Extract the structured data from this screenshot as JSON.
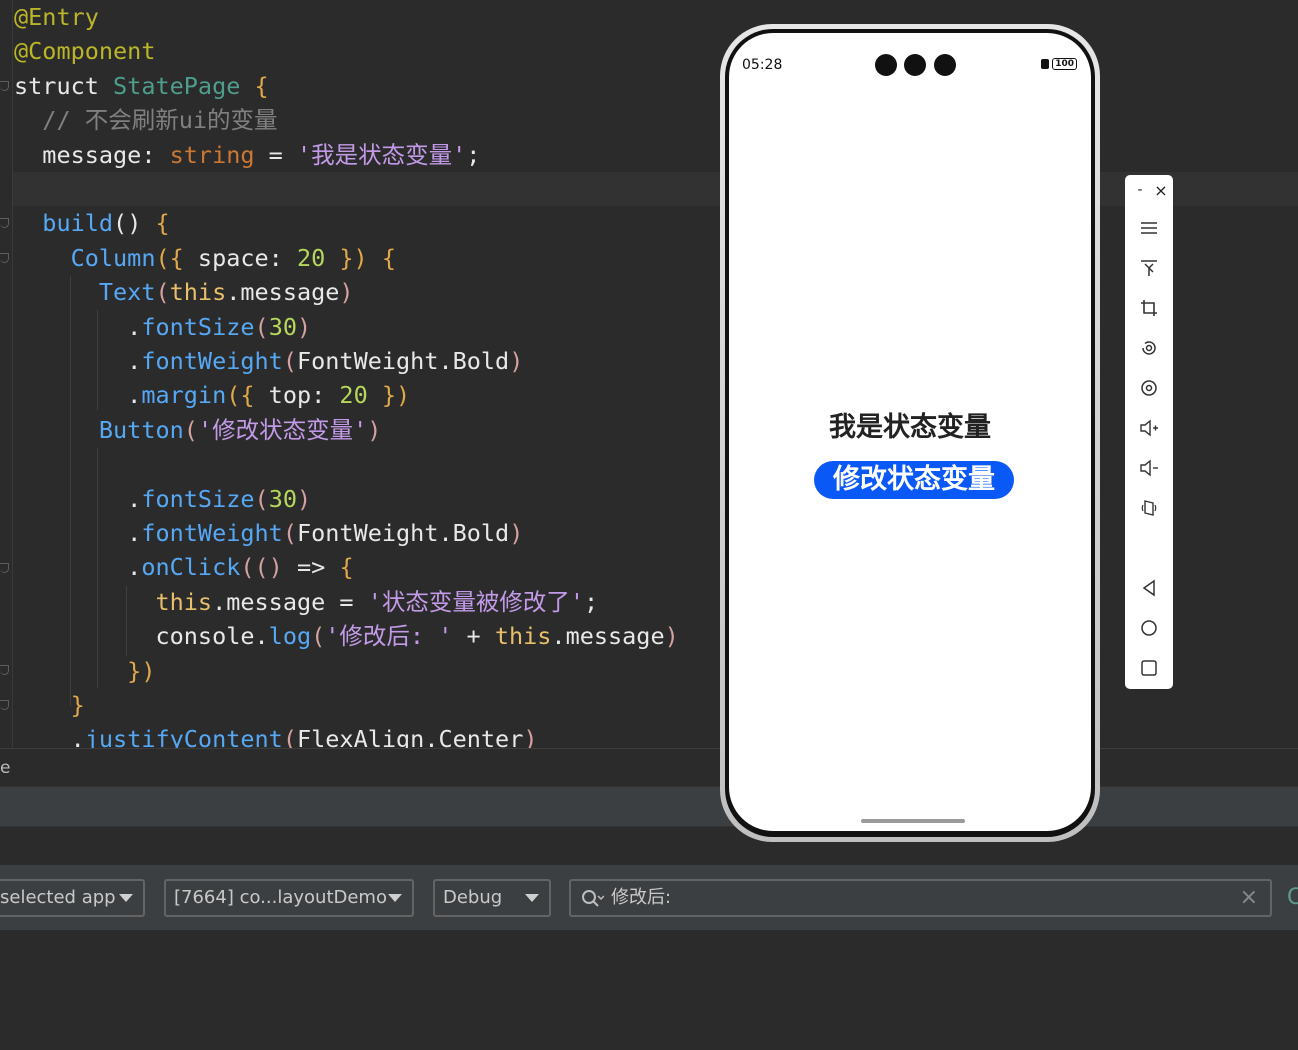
{
  "editor": {
    "lines": [
      {
        "parts": [
          [
            "ann",
            "@Entry"
          ]
        ]
      },
      {
        "parts": [
          [
            "ann",
            "@Component"
          ]
        ]
      },
      {
        "parts": [
          [
            "plain",
            "struct "
          ],
          [
            "cls",
            "StatePage"
          ],
          [
            "plain",
            " "
          ],
          [
            "punc",
            "{"
          ]
        ]
      },
      {
        "parts": [
          [
            "cmt",
            "  // 不会刷新ui的变量"
          ]
        ]
      },
      {
        "parts": [
          [
            "plain",
            "  message"
          ],
          [
            "plain",
            ": "
          ],
          [
            "kw",
            "string"
          ],
          [
            "plain",
            " = "
          ],
          [
            "str",
            "'我是状态变量'"
          ],
          [
            "plain",
            ";"
          ]
        ]
      },
      {
        "parts": [
          [
            "plain",
            ""
          ]
        ]
      },
      {
        "parts": [
          [
            "fn",
            "  build"
          ],
          [
            "plain",
            "() "
          ],
          [
            "punc",
            "{"
          ]
        ]
      },
      {
        "parts": [
          [
            "fn",
            "    Column"
          ],
          [
            "punc",
            "({"
          ],
          [
            "plain",
            " space: "
          ],
          [
            "num",
            "20"
          ],
          [
            "punc",
            " })"
          ],
          [
            "plain",
            " "
          ],
          [
            "punc",
            "{"
          ]
        ]
      },
      {
        "parts": [
          [
            "fn",
            "      Text"
          ],
          [
            "par",
            "("
          ],
          [
            "this",
            "this"
          ],
          [
            "plain",
            ".message"
          ],
          [
            "par",
            ")"
          ]
        ]
      },
      {
        "parts": [
          [
            "plain",
            "        ."
          ],
          [
            "fn",
            "fontSize"
          ],
          [
            "par",
            "("
          ],
          [
            "num",
            "30"
          ],
          [
            "par",
            ")"
          ]
        ]
      },
      {
        "parts": [
          [
            "plain",
            "        ."
          ],
          [
            "fn",
            "fontWeight"
          ],
          [
            "par",
            "("
          ],
          [
            "plain",
            "FontWeight.Bold"
          ],
          [
            "par",
            ")"
          ]
        ]
      },
      {
        "parts": [
          [
            "plain",
            "        ."
          ],
          [
            "fn",
            "margin"
          ],
          [
            "punc",
            "({"
          ],
          [
            "plain",
            " top: "
          ],
          [
            "num",
            "20"
          ],
          [
            "punc",
            " })"
          ]
        ]
      },
      {
        "parts": [
          [
            "fn",
            "      Button"
          ],
          [
            "par",
            "("
          ],
          [
            "str",
            "'修改状态变量'"
          ],
          [
            "par",
            ")"
          ]
        ]
      },
      {
        "parts": [
          [
            "plain",
            ""
          ]
        ]
      },
      {
        "parts": [
          [
            "plain",
            "        ."
          ],
          [
            "fn",
            "fontSize"
          ],
          [
            "par",
            "("
          ],
          [
            "num",
            "30"
          ],
          [
            "par",
            ")"
          ]
        ]
      },
      {
        "parts": [
          [
            "plain",
            "        ."
          ],
          [
            "fn",
            "fontWeight"
          ],
          [
            "par",
            "("
          ],
          [
            "plain",
            "FontWeight.Bold"
          ],
          [
            "par",
            ")"
          ]
        ]
      },
      {
        "parts": [
          [
            "plain",
            "        ."
          ],
          [
            "fn",
            "onClick"
          ],
          [
            "par",
            "(()"
          ],
          [
            "plain",
            " => "
          ],
          [
            "punc",
            "{"
          ]
        ]
      },
      {
        "parts": [
          [
            "this",
            "          this"
          ],
          [
            "plain",
            ".message = "
          ],
          [
            "str",
            "'状态变量被修改了'"
          ],
          [
            "plain",
            ";"
          ]
        ]
      },
      {
        "parts": [
          [
            "plain",
            "          console."
          ],
          [
            "fn",
            "log"
          ],
          [
            "par",
            "("
          ],
          [
            "str",
            "'修改后: '"
          ],
          [
            "plain",
            " + "
          ],
          [
            "this",
            "this"
          ],
          [
            "plain",
            ".message"
          ],
          [
            "par",
            ")"
          ]
        ]
      },
      {
        "parts": [
          [
            "punc",
            "        })"
          ]
        ]
      },
      {
        "parts": [
          [
            "punc",
            "    }"
          ]
        ]
      },
      {
        "parts": [
          [
            "plain",
            "    ."
          ],
          [
            "fn",
            "justifyContent"
          ],
          [
            "par",
            "("
          ],
          [
            "plain",
            "FlexAlign.Center"
          ],
          [
            "par",
            ")"
          ]
        ]
      }
    ]
  },
  "status_strip": {
    "text": "e"
  },
  "logcat": {
    "app_filter": "selected app",
    "process": "[7664] co...layoutDemo",
    "level": "Debug",
    "search_value": "修改后:",
    "clear_glyph": "×",
    "edge_glyph": "C"
  },
  "phone": {
    "time": "05:28",
    "battery": "100",
    "app_text": "我是状态变量",
    "button_label": "修改状态变量",
    "button_color": "#0a59f7"
  },
  "side_toolbar": {
    "minimize": "-",
    "close": "×",
    "icons": [
      "menu-icon",
      "pin-icon",
      "crop-icon",
      "rotate-icon",
      "screenshot-icon",
      "volume-up-icon",
      "volume-down-icon",
      "fold-icon",
      "back-icon",
      "home-icon",
      "recents-icon"
    ]
  }
}
